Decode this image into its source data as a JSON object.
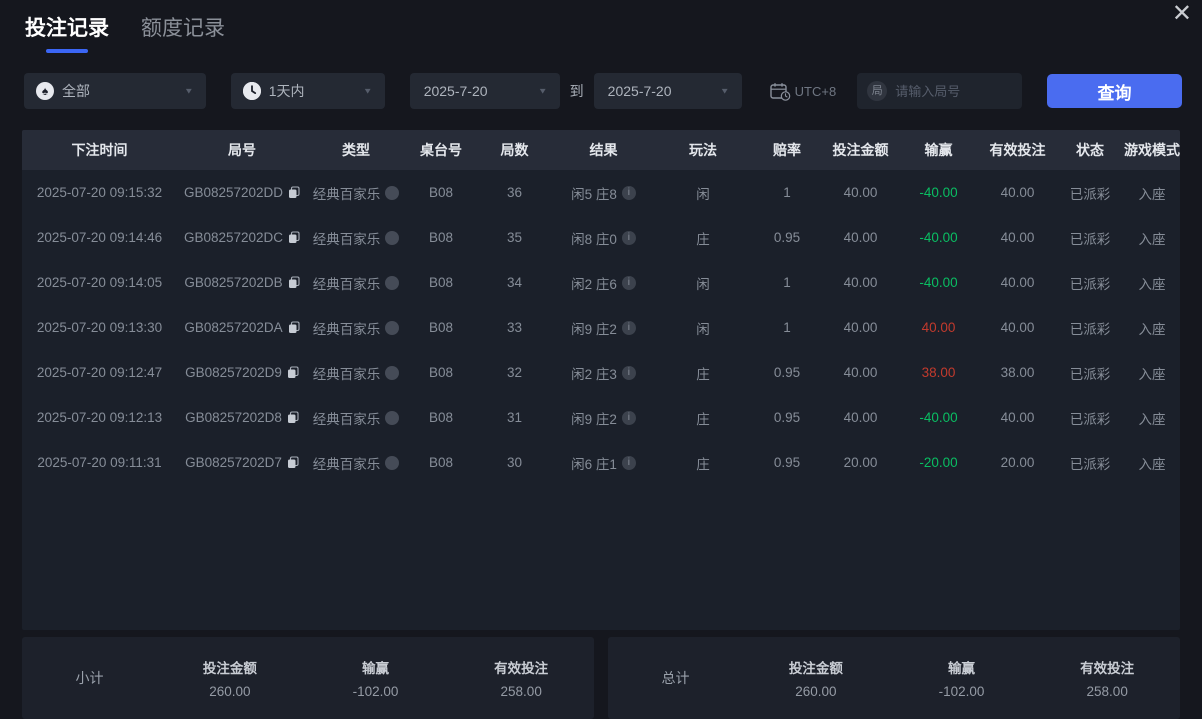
{
  "icons": {
    "close": "✕",
    "chevron": "▼",
    "spade": "♠",
    "info": "i",
    "round_search": "局"
  },
  "tabs": [
    {
      "label": "投注记录",
      "active": true
    },
    {
      "label": "额度记录",
      "active": false
    }
  ],
  "filters": {
    "game_type": {
      "value": "全部"
    },
    "time_range": {
      "value": "1天内"
    },
    "date_from": "2025-7-20",
    "to_label": "到",
    "date_to": "2025-7-20",
    "timezone": "UTC+8",
    "search_placeholder": "请输入局号",
    "query_button": "查询"
  },
  "table": {
    "columns": [
      "下注时间",
      "局号",
      "类型",
      "桌台号",
      "局数",
      "结果",
      "玩法",
      "赔率",
      "投注金额",
      "输赢",
      "有效投注",
      "状态",
      "游戏模式"
    ],
    "rows": [
      {
        "time": "2025-07-20 09:15:32",
        "round_id": "GB08257202DD",
        "type": "经典百家乐",
        "table_no": "B08",
        "round_no": "36",
        "result": "闲5 庄8",
        "play": "闲",
        "odds": "1",
        "bet": "40.00",
        "win": "-40.00",
        "win_color": "green",
        "valid": "40.00",
        "status": "已派彩",
        "mode": "入座"
      },
      {
        "time": "2025-07-20 09:14:46",
        "round_id": "GB08257202DC",
        "type": "经典百家乐",
        "table_no": "B08",
        "round_no": "35",
        "result": "闲8 庄0",
        "play": "庄",
        "odds": "0.95",
        "bet": "40.00",
        "win": "-40.00",
        "win_color": "green",
        "valid": "40.00",
        "status": "已派彩",
        "mode": "入座"
      },
      {
        "time": "2025-07-20 09:14:05",
        "round_id": "GB08257202DB",
        "type": "经典百家乐",
        "table_no": "B08",
        "round_no": "34",
        "result": "闲2 庄6",
        "play": "闲",
        "odds": "1",
        "bet": "40.00",
        "win": "-40.00",
        "win_color": "green",
        "valid": "40.00",
        "status": "已派彩",
        "mode": "入座"
      },
      {
        "time": "2025-07-20 09:13:30",
        "round_id": "GB08257202DA",
        "type": "经典百家乐",
        "table_no": "B08",
        "round_no": "33",
        "result": "闲9 庄2",
        "play": "闲",
        "odds": "1",
        "bet": "40.00",
        "win": "40.00",
        "win_color": "red",
        "valid": "40.00",
        "status": "已派彩",
        "mode": "入座"
      },
      {
        "time": "2025-07-20 09:12:47",
        "round_id": "GB08257202D9",
        "type": "经典百家乐",
        "table_no": "B08",
        "round_no": "32",
        "result": "闲2 庄3",
        "play": "庄",
        "odds": "0.95",
        "bet": "40.00",
        "win": "38.00",
        "win_color": "red",
        "valid": "38.00",
        "status": "已派彩",
        "mode": "入座"
      },
      {
        "time": "2025-07-20 09:12:13",
        "round_id": "GB08257202D8",
        "type": "经典百家乐",
        "table_no": "B08",
        "round_no": "31",
        "result": "闲9 庄2",
        "play": "庄",
        "odds": "0.95",
        "bet": "40.00",
        "win": "-40.00",
        "win_color": "green",
        "valid": "40.00",
        "status": "已派彩",
        "mode": "入座"
      },
      {
        "time": "2025-07-20 09:11:31",
        "round_id": "GB08257202D7",
        "type": "经典百家乐",
        "table_no": "B08",
        "round_no": "30",
        "result": "闲6 庄1",
        "play": "庄",
        "odds": "0.95",
        "bet": "20.00",
        "win": "-20.00",
        "win_color": "green",
        "valid": "20.00",
        "status": "已派彩",
        "mode": "入座"
      }
    ]
  },
  "summary": {
    "subtotal": {
      "label": "小计",
      "bet_label": "投注金额",
      "bet": "260.00",
      "win_label": "输赢",
      "win": "-102.00",
      "valid_label": "有效投注",
      "valid": "258.00"
    },
    "total": {
      "label": "总计",
      "bet_label": "投注金额",
      "bet": "260.00",
      "win_label": "输赢",
      "win": "-102.00",
      "valid_label": "有效投注",
      "valid": "258.00"
    }
  },
  "colors": {
    "accent_blue": "#4a6cf0",
    "win_red": "#c23a2d",
    "loss_green": "#0abd62"
  }
}
